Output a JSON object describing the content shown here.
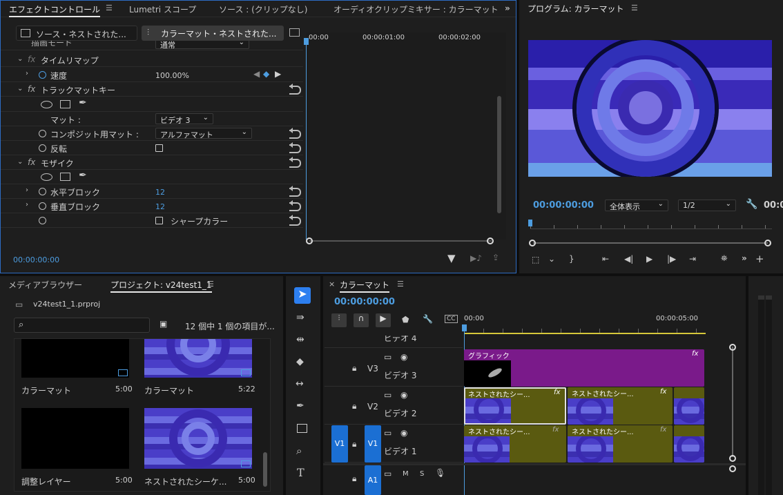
{
  "effect_controls": {
    "tabs": [
      "エフェクトコントロール",
      "Lumetri スコープ",
      "ソース : (クリップなし)",
      "オーディオクリップミキサー : カラーマット"
    ],
    "source_clip": "ソース・ネストされた...",
    "active_clip": "カラーマット・ネストされた...",
    "timecodes": [
      "00:00",
      "00:00:01:00",
      "00:00:02:00"
    ],
    "partial_row": "描画モード",
    "partial_row_value": "通常",
    "time_remap": "タイムリマップ",
    "speed_label": "速度",
    "speed_value": "100.00%",
    "track_matte": "トラックマットキー",
    "matte_label": "マット :",
    "matte_value": "ビデオ 3",
    "composite_label": "コンポジット用マット :",
    "composite_value": "アルファマット",
    "reverse_label": "反転",
    "mosaic": "モザイク",
    "horiz_label": "水平ブロック",
    "horiz_value": "12",
    "vert_label": "垂直ブロック",
    "vert_value": "12",
    "sharp_label": "シャープカラー",
    "current_time": "00:00:00:00",
    "fx": "fx"
  },
  "program": {
    "title": "プログラム: カラーマット",
    "timecode": "00:00:00:00",
    "fit": "全体表示",
    "quality": "1/2",
    "right_timecode": "00:0"
  },
  "project": {
    "tabs": [
      "メディアブラウザー",
      "プロジェクト: v24test1_1"
    ],
    "file": "v24test1_1.prproj",
    "count": "12 個中 1 個の項目が...",
    "items": [
      {
        "name": "カラーマット",
        "duration": "5:00"
      },
      {
        "name": "カラーマット",
        "duration": "5:22"
      },
      {
        "name": "調整レイヤー",
        "duration": "5:00"
      },
      {
        "name": "ネストされたシーケ...",
        "duration": "5:00"
      }
    ]
  },
  "timeline": {
    "title": "カラーマット",
    "timecode": "00:00:00:00",
    "ruler": [
      "00:00",
      "00:00:05:00"
    ],
    "tracks": [
      {
        "id": "",
        "name": "ビデオ 4"
      },
      {
        "id": "V3",
        "name": "ビデオ 3"
      },
      {
        "id": "V2",
        "name": "ビデオ 2"
      },
      {
        "id": "V1",
        "name": "ビデオ 1"
      },
      {
        "id": "A1",
        "name": ""
      }
    ],
    "source_patch": "V1",
    "graphic_clip": "グラフィック",
    "nest_clip": "ネストされたシー...",
    "audio_m": "M",
    "audio_s": "S",
    "fx": "fx"
  },
  "colors": {
    "accent": "#2d8ceb",
    "graphic": "#7a1a8a",
    "nest": "#5a5a10",
    "selected": "#d8d8d8"
  }
}
